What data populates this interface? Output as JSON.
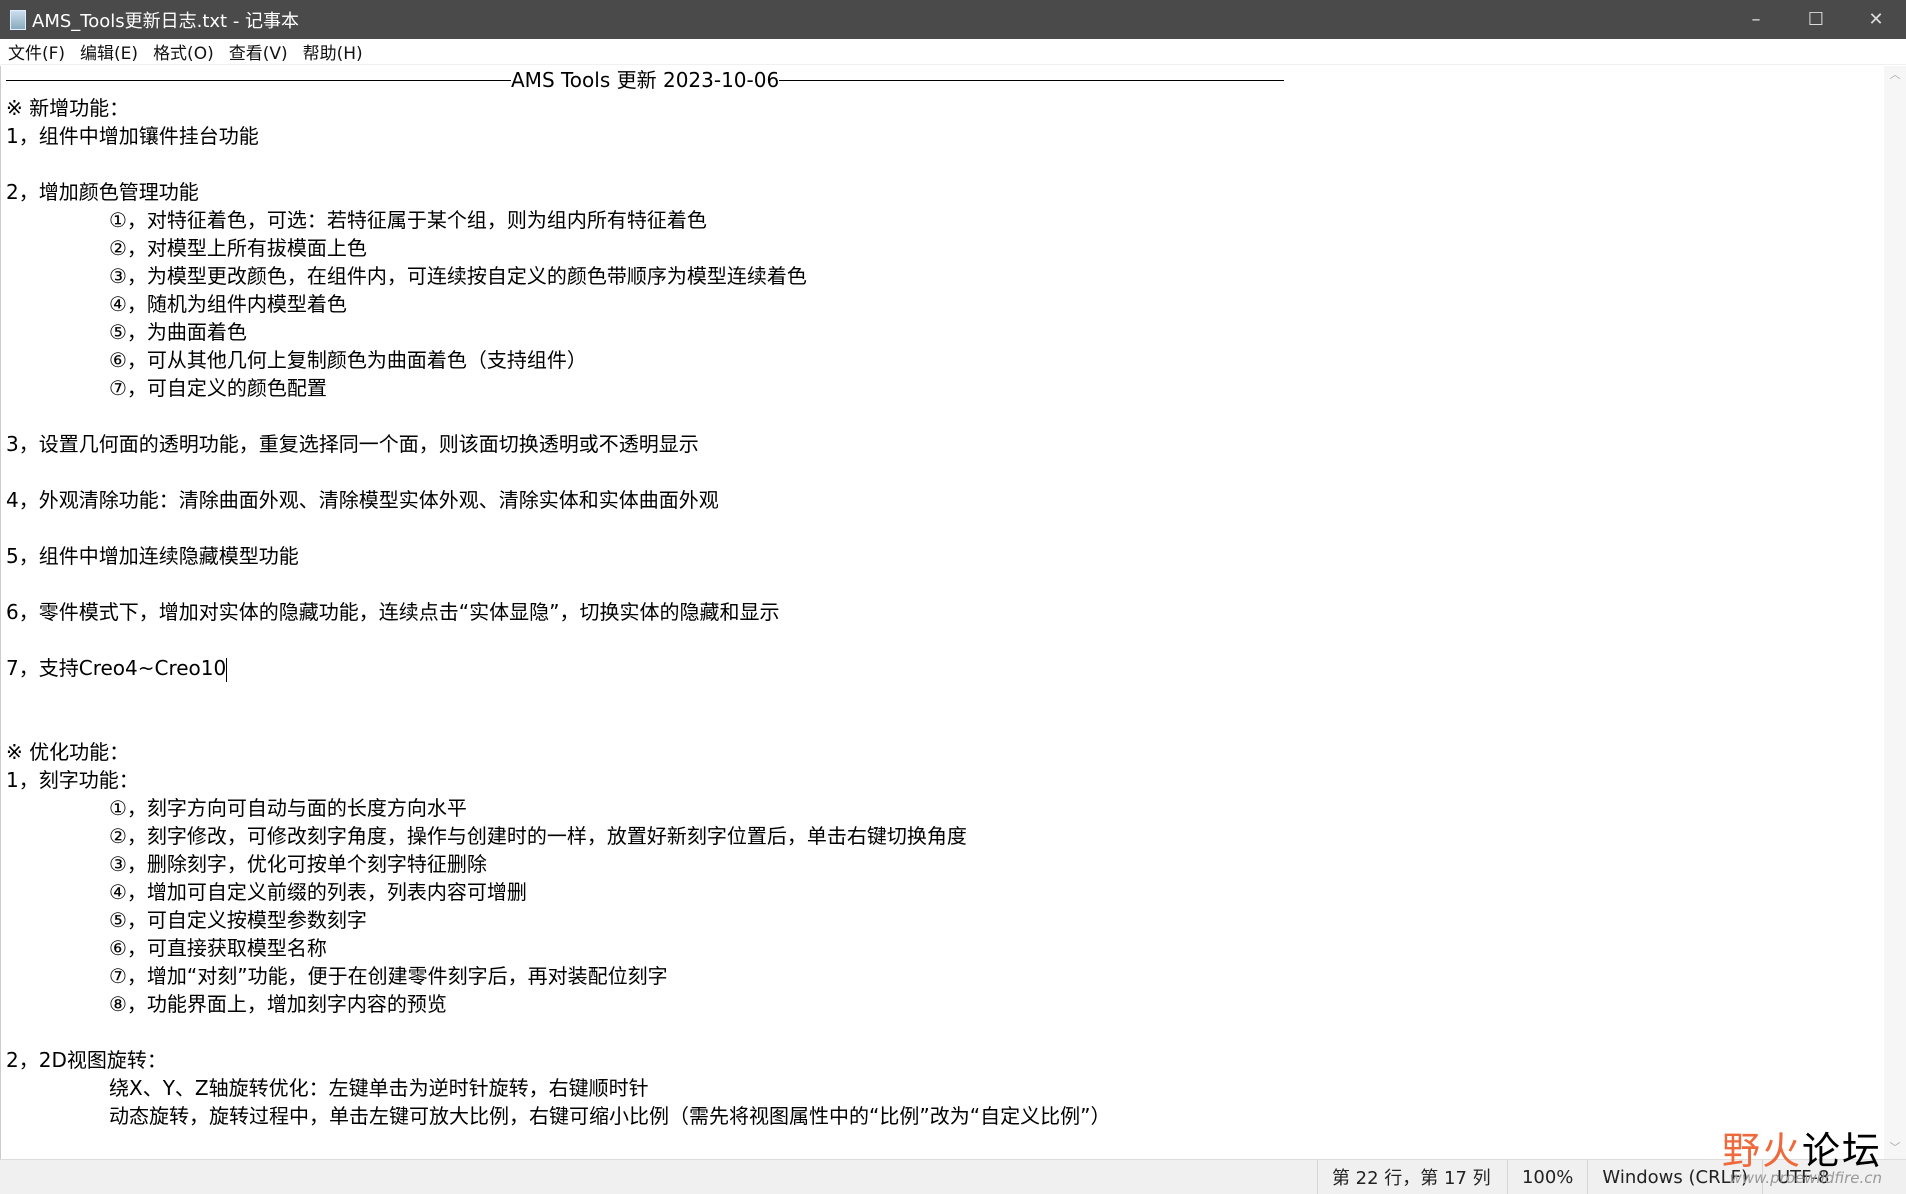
{
  "window": {
    "title": "AMS_Tools更新日志.txt - 记事本",
    "minimize": "–",
    "maximize": "☐",
    "close": "✕"
  },
  "menu": [
    "文件(F)",
    "编辑(E)",
    "格式(O)",
    "查看(V)",
    "帮助(H)"
  ],
  "header": "AMS Tools 更新 2023-10-06",
  "lines": [
    {
      "t": "※ 新增功能：",
      "i": 0
    },
    {
      "t": "1，组件中增加镶件挂台功能",
      "i": 0
    },
    {
      "t": "",
      "i": 0
    },
    {
      "t": "2，增加颜色管理功能",
      "i": 0
    },
    {
      "t": "①，对特征着色，可选：若特征属于某个组，则为组内所有特征着色",
      "i": 1
    },
    {
      "t": "②，对模型上所有拔模面上色",
      "i": 1
    },
    {
      "t": "③，为模型更改颜色，在组件内，可连续按自定义的颜色带顺序为模型连续着色",
      "i": 1
    },
    {
      "t": "④，随机为组件内模型着色",
      "i": 1
    },
    {
      "t": "⑤，为曲面着色",
      "i": 1
    },
    {
      "t": "⑥，可从其他几何上复制颜色为曲面着色（支持组件）",
      "i": 1
    },
    {
      "t": "⑦，可自定义的颜色配置",
      "i": 1
    },
    {
      "t": "",
      "i": 0
    },
    {
      "t": "3，设置几何面的透明功能，重复选择同一个面，则该面切换透明或不透明显示",
      "i": 0
    },
    {
      "t": "",
      "i": 0
    },
    {
      "t": "4，外观清除功能：清除曲面外观、清除模型实体外观、清除实体和实体曲面外观",
      "i": 0
    },
    {
      "t": "",
      "i": 0
    },
    {
      "t": "5，组件中增加连续隐藏模型功能",
      "i": 0
    },
    {
      "t": "",
      "i": 0
    },
    {
      "t": "6，零件模式下，增加对实体的隐藏功能，连续点击“实体显隐”，切换实体的隐藏和显示",
      "i": 0
    },
    {
      "t": "",
      "i": 0
    },
    {
      "t": "7，支持Creo4~Creo10",
      "i": 0,
      "cursor": true
    },
    {
      "t": "",
      "i": 0
    },
    {
      "t": "",
      "i": 0
    },
    {
      "t": "※ 优化功能：",
      "i": 0
    },
    {
      "t": "1，刻字功能：",
      "i": 0
    },
    {
      "t": "①，刻字方向可自动与面的长度方向水平",
      "i": 1
    },
    {
      "t": "②，刻字修改，可修改刻字角度，操作与创建时的一样，放置好新刻字位置后，单击右键切换角度",
      "i": 1
    },
    {
      "t": "③，删除刻字，优化可按单个刻字特征删除",
      "i": 1
    },
    {
      "t": "④，增加可自定义前缀的列表，列表内容可增删",
      "i": 1
    },
    {
      "t": "⑤，可自定义按模型参数刻字",
      "i": 1
    },
    {
      "t": "⑥，可直接获取模型名称",
      "i": 1
    },
    {
      "t": "⑦，增加“对刻”功能，便于在创建零件刻字后，再对装配位刻字",
      "i": 1
    },
    {
      "t": "⑧，功能界面上，增加刻字内容的预览",
      "i": 1
    },
    {
      "t": "",
      "i": 0
    },
    {
      "t": "2，2D视图旋转：",
      "i": 0
    },
    {
      "t": "绕X、Y、Z轴旋转优化：左键单击为逆时针旋转，右键顺时针",
      "i": 1
    },
    {
      "t": "动态旋转，旋转过程中，单击左键可放大比例，右键可缩小比例（需先将视图属性中的“比例”改为“自定义比例”）",
      "i": 1
    }
  ],
  "status": {
    "position": "第 22 行，第 17 列",
    "zoom": "100%",
    "eol": "Windows (CRLF)",
    "encoding": "UTF-8"
  },
  "watermark": {
    "a": "野火",
    "b": "论坛",
    "url": "www.proewildfire.cn"
  }
}
